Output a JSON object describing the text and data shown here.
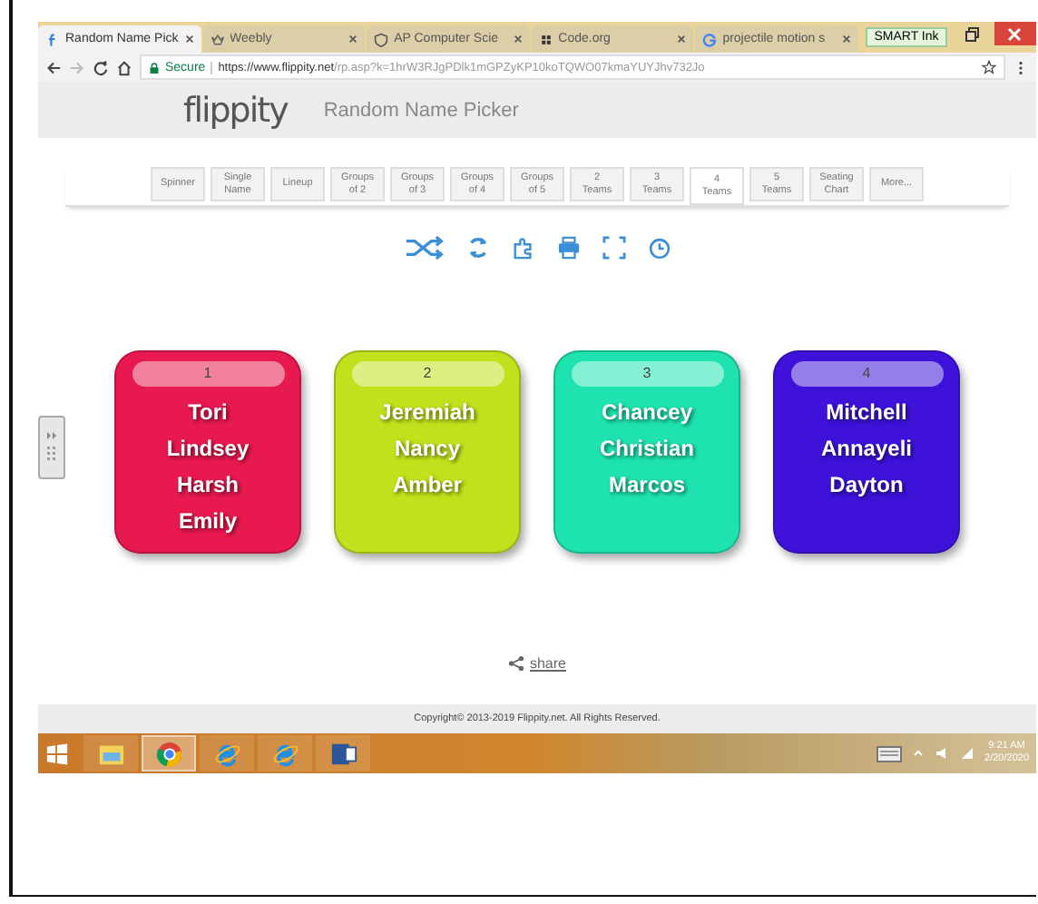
{
  "browser": {
    "tabs": [
      {
        "title": "Random Name Pick",
        "selected": true
      },
      {
        "title": "Weebly",
        "selected": false
      },
      {
        "title": "AP Computer Scie",
        "selected": false
      },
      {
        "title": "Code.org",
        "selected": false
      },
      {
        "title": "projectile motion s",
        "selected": false
      }
    ],
    "smart_ink": "SMART Ink",
    "secure": "Secure",
    "url_host": "https://www.flippity.net",
    "url_path": "/rp.asp?k=1hrW3RJgPDlk1mGPZyKP10koTQWO07kmaYUYJhv732Jo"
  },
  "page": {
    "logo": "flippity",
    "title": "Random Name Picker",
    "modes": [
      {
        "lines": [
          "Spinner"
        ],
        "selected": false
      },
      {
        "lines": [
          "Single",
          "Name"
        ],
        "selected": false
      },
      {
        "lines": [
          "Lineup"
        ],
        "selected": false
      },
      {
        "lines": [
          "Groups",
          "of 2"
        ],
        "selected": false
      },
      {
        "lines": [
          "Groups",
          "of 3"
        ],
        "selected": false
      },
      {
        "lines": [
          "Groups",
          "of 4"
        ],
        "selected": false
      },
      {
        "lines": [
          "Groups",
          "of 5"
        ],
        "selected": false
      },
      {
        "lines": [
          "2",
          "Teams"
        ],
        "selected": false
      },
      {
        "lines": [
          "3",
          "Teams"
        ],
        "selected": false
      },
      {
        "lines": [
          "4",
          "Teams"
        ],
        "selected": true
      },
      {
        "lines": [
          "5",
          "Teams"
        ],
        "selected": false
      },
      {
        "lines": [
          "Seating",
          "Chart"
        ],
        "selected": false
      },
      {
        "lines": [
          "More..."
        ],
        "selected": false
      }
    ],
    "teams": [
      {
        "number": "1",
        "color": "#e8194f",
        "names": [
          "Tori",
          "Lindsey",
          "Harsh",
          "Emily"
        ]
      },
      {
        "number": "2",
        "color": "#bfe21c",
        "names": [
          "Jeremiah",
          "Nancy",
          "Amber"
        ]
      },
      {
        "number": "3",
        "color": "#1ee3b0",
        "names": [
          "Chancey",
          "Christian",
          "Marcos"
        ]
      },
      {
        "number": "4",
        "color": "#3e12d9",
        "names": [
          "Mitchell",
          "Annayeli",
          "Dayton"
        ]
      }
    ],
    "share": "share",
    "copyright": "Copyright© 2013-2019 Flippity.net. All Rights Reserved."
  },
  "taskbar": {
    "apps": [
      {
        "kind": "explorer",
        "selected": false
      },
      {
        "kind": "chrome",
        "selected": true
      },
      {
        "kind": "ie",
        "selected": false
      },
      {
        "kind": "ie",
        "selected": false
      },
      {
        "kind": "word",
        "selected": false
      }
    ],
    "time": "9:21 AM",
    "date": "2/20/2020"
  }
}
